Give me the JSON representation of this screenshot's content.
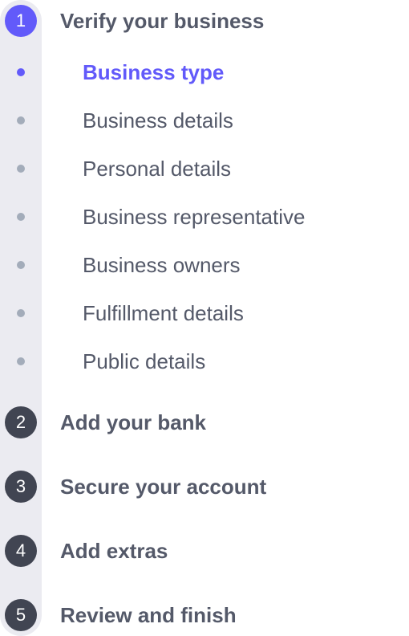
{
  "colors": {
    "accent": "#625afa",
    "inactive_badge": "#414552",
    "text": "#545969",
    "dot": "#a3acba",
    "track": "#ebebf1"
  },
  "steps": [
    {
      "number": "1",
      "label": "Verify your business",
      "state": "active",
      "substeps": [
        {
          "label": "Business type",
          "state": "current"
        },
        {
          "label": "Business details",
          "state": "pending"
        },
        {
          "label": "Personal details",
          "state": "pending"
        },
        {
          "label": "Business representative",
          "state": "pending"
        },
        {
          "label": "Business owners",
          "state": "pending"
        },
        {
          "label": "Fulfillment details",
          "state": "pending"
        },
        {
          "label": "Public details",
          "state": "pending"
        }
      ]
    },
    {
      "number": "2",
      "label": "Add your bank",
      "state": "upcoming"
    },
    {
      "number": "3",
      "label": "Secure your account",
      "state": "upcoming"
    },
    {
      "number": "4",
      "label": "Add extras",
      "state": "upcoming"
    },
    {
      "number": "5",
      "label": "Review and finish",
      "state": "upcoming"
    }
  ]
}
